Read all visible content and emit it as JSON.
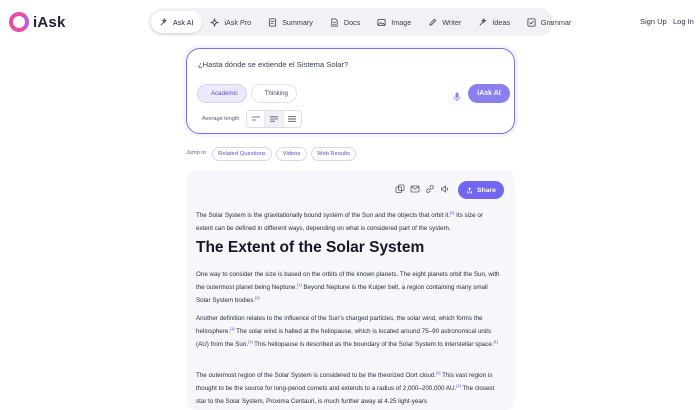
{
  "brand": {
    "name": "iAsk"
  },
  "nav": {
    "items": [
      {
        "label": "Ask AI",
        "icon": "sparkle-icon",
        "active": true
      },
      {
        "label": "iAsk Pro",
        "icon": "sparkle-pro-icon",
        "active": false
      },
      {
        "label": "Summary",
        "icon": "summary-icon",
        "active": false
      },
      {
        "label": "Docs",
        "icon": "docs-icon",
        "active": false
      },
      {
        "label": "Image",
        "icon": "image-icon",
        "active": false
      },
      {
        "label": "Writer",
        "icon": "pen-icon",
        "active": false
      },
      {
        "label": "Ideas",
        "icon": "ideas-icon",
        "active": false
      },
      {
        "label": "Grammar",
        "icon": "grammar-icon",
        "active": false
      }
    ]
  },
  "auth": {
    "signup": "Sign Up",
    "login": "Log In"
  },
  "search": {
    "query": "¿Hasta dónde se extiende el Sistema Solar?",
    "modes": {
      "academic": "Academic",
      "thinking": "Thinking"
    },
    "ask_label": "iAsk AI",
    "length_label": "Average length"
  },
  "jump": {
    "label": "Jump to",
    "chips": [
      "Related Questions",
      "Videos",
      "Web Results"
    ]
  },
  "answer": {
    "share_label": "Share",
    "intro": "The Solar System is the gravitationally bound system of the Sun and the objects that orbit it.",
    "intro_tail": " Its size or extent can be defined in different ways, depending on what is considered part of the system.",
    "heading": "The Extent of the Solar System",
    "p2a": "One way to consider the size is based on the orbits of the known planets. The eight planets orbit the Sun, with the outermost planet being Neptune.",
    "p2b": " Beyond Neptune is the Kuiper belt, a region containing many small Solar System bodies.",
    "p3a": "Another definition relates to the influence of the Sun's charged particles, the solar wind, which forms the heliosphere.",
    "p3b": " The solar wind is halted at the heliopause, which is located around 75–90 astronomical units (AU) from the Sun.",
    "p3c": " This heliopause is described as the boundary of the Solar System to interstellar space.",
    "p4a": "The outermost region of the Solar System is considered to be the theorized Oort cloud.",
    "p4b": " This vast region is thought to be the source for long-period comets and extends to a radius of 2,000–200,000 AU.",
    "p4c": " The closest star to the Solar System, Proxima Centauri, is much further away at 4.25 light-years",
    "cite": "[1]"
  },
  "colors": {
    "accent": "#7265ee",
    "brand_pink": "#e64ea6",
    "panel": "#f6f6fb"
  }
}
